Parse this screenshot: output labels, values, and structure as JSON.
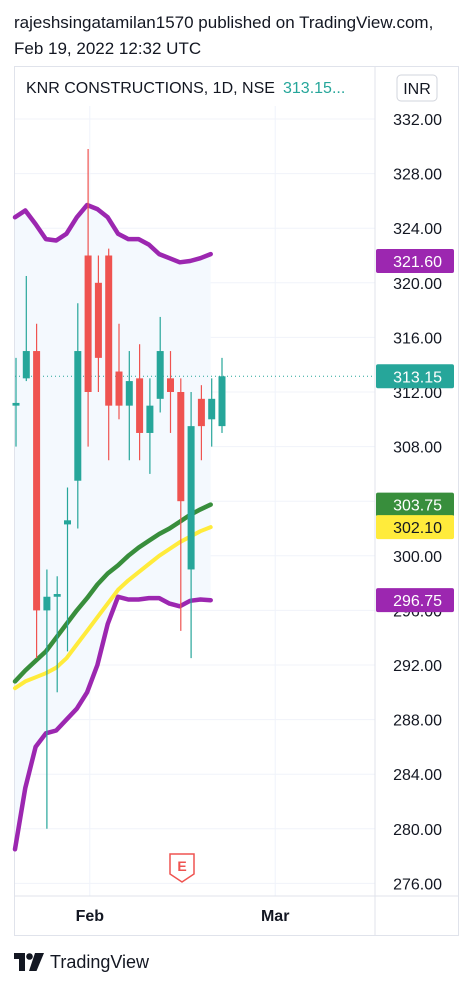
{
  "header": {
    "published_by": "rajeshsingatamilan1570 published on TradingView.com,",
    "published_at": "Feb 19, 2022 12:32 UTC"
  },
  "chart_data": {
    "type": "candlestick",
    "title": "KNR CONSTRUCTIONS, 1D, NSE",
    "last_price_label": "313.15...",
    "currency": "INR",
    "y_ticks": [
      "332.00",
      "328.00",
      "324.00",
      "320.00",
      "316.00",
      "312.00",
      "308.00",
      "304.00",
      "300.00",
      "296.00",
      "292.00",
      "288.00",
      "284.00",
      "280.00",
      "276.00"
    ],
    "ylim": [
      275.5,
      333
    ],
    "x_ticks": [
      {
        "label": "Feb",
        "index": 6
      },
      {
        "label": "Mar",
        "index": 24
      }
    ],
    "price_badges": [
      {
        "label": "321.60",
        "value": 321.6,
        "color": "#9c27b0"
      },
      {
        "label": "313.15",
        "value": 313.15,
        "color": "#26a69a"
      },
      {
        "label": "303.75",
        "value": 303.75,
        "color": "#388e3c"
      },
      {
        "label": "302.10",
        "value": 302.1,
        "color": "#ffeb3b"
      },
      {
        "label": "296.75",
        "value": 296.75,
        "color": "#9c27b0"
      }
    ],
    "candles": [
      {
        "o": 311.0,
        "h": 314.5,
        "l": 308.0,
        "c": 311.2
      },
      {
        "o": 313.0,
        "h": 320.5,
        "l": 312.8,
        "c": 315.0
      },
      {
        "o": 315.0,
        "h": 317.0,
        "l": 292.5,
        "c": 296.0
      },
      {
        "o": 296.0,
        "h": 299.0,
        "l": 280.0,
        "c": 297.0
      },
      {
        "o": 297.0,
        "h": 298.5,
        "l": 290.0,
        "c": 297.2
      },
      {
        "o": 302.3,
        "h": 305.0,
        "l": 293.0,
        "c": 302.6
      },
      {
        "o": 305.5,
        "h": 318.5,
        "l": 302.0,
        "c": 315.0
      },
      {
        "o": 322.0,
        "h": 329.8,
        "l": 308.0,
        "c": 312.0
      },
      {
        "o": 320.0,
        "h": 322.0,
        "l": 312.0,
        "c": 314.5
      },
      {
        "o": 322.0,
        "h": 322.5,
        "l": 307.0,
        "c": 311.0
      },
      {
        "o": 313.5,
        "h": 317.0,
        "l": 310.0,
        "c": 311.0
      },
      {
        "o": 311.0,
        "h": 315.0,
        "l": 307.0,
        "c": 312.8
      },
      {
        "o": 313.0,
        "h": 315.5,
        "l": 307.0,
        "c": 309.0
      },
      {
        "o": 309.0,
        "h": 313.0,
        "l": 306.0,
        "c": 311.0
      },
      {
        "o": 311.5,
        "h": 317.5,
        "l": 310.5,
        "c": 315.0
      },
      {
        "o": 313.0,
        "h": 315.0,
        "l": 309.0,
        "c": 312.0
      },
      {
        "o": 312.0,
        "h": 313.0,
        "l": 294.5,
        "c": 304.0
      },
      {
        "o": 299.0,
        "h": 312.0,
        "l": 292.5,
        "c": 309.5
      },
      {
        "o": 311.5,
        "h": 312.5,
        "l": 307.0,
        "c": 309.5
      },
      {
        "o": 310.0,
        "h": 313.0,
        "l": 308.0,
        "c": 311.5
      },
      {
        "o": 309.5,
        "h": 314.5,
        "l": 309.0,
        "c": 313.15
      }
    ],
    "series": [
      {
        "color": "#9c27b0",
        "values": [
          324.8,
          325.3,
          324.3,
          323.2,
          323.1,
          323.6,
          324.8,
          325.7,
          325.4,
          324.8,
          323.6,
          323.2,
          323.2,
          322.8,
          322.1,
          321.8,
          321.5,
          321.6,
          321.8,
          322.1
        ]
      },
      {
        "color": "#9c27b0",
        "values": [
          278.5,
          283.0,
          286.0,
          287.0,
          287.2,
          288.0,
          288.8,
          290.0,
          292.0,
          295.0,
          297.0,
          296.8,
          296.8,
          296.9,
          296.9,
          296.5,
          296.3,
          296.7,
          296.8,
          296.75
        ]
      },
      {
        "color": "#388e3c",
        "values": [
          290.8,
          291.6,
          292.3,
          293.0,
          294.0,
          295.0,
          296.0,
          296.9,
          297.9,
          298.7,
          299.3,
          300.0,
          300.6,
          301.1,
          301.6,
          302.0,
          302.5,
          303.0,
          303.4,
          303.75
        ]
      },
      {
        "color": "#ffeb3b",
        "values": [
          290.3,
          290.8,
          291.1,
          291.4,
          291.8,
          292.5,
          293.5,
          294.5,
          295.5,
          296.5,
          297.5,
          298.2,
          298.8,
          299.4,
          300.0,
          300.5,
          301.0,
          301.4,
          301.8,
          302.1
        ]
      }
    ],
    "earnings_marker": "E"
  },
  "footer": {
    "brand": "TradingView"
  },
  "colors": {
    "up": "#26a69a",
    "down": "#ef5350",
    "grid": "#f0f3fa",
    "band_fill": "#f4f9fe",
    "text": "#131722"
  }
}
